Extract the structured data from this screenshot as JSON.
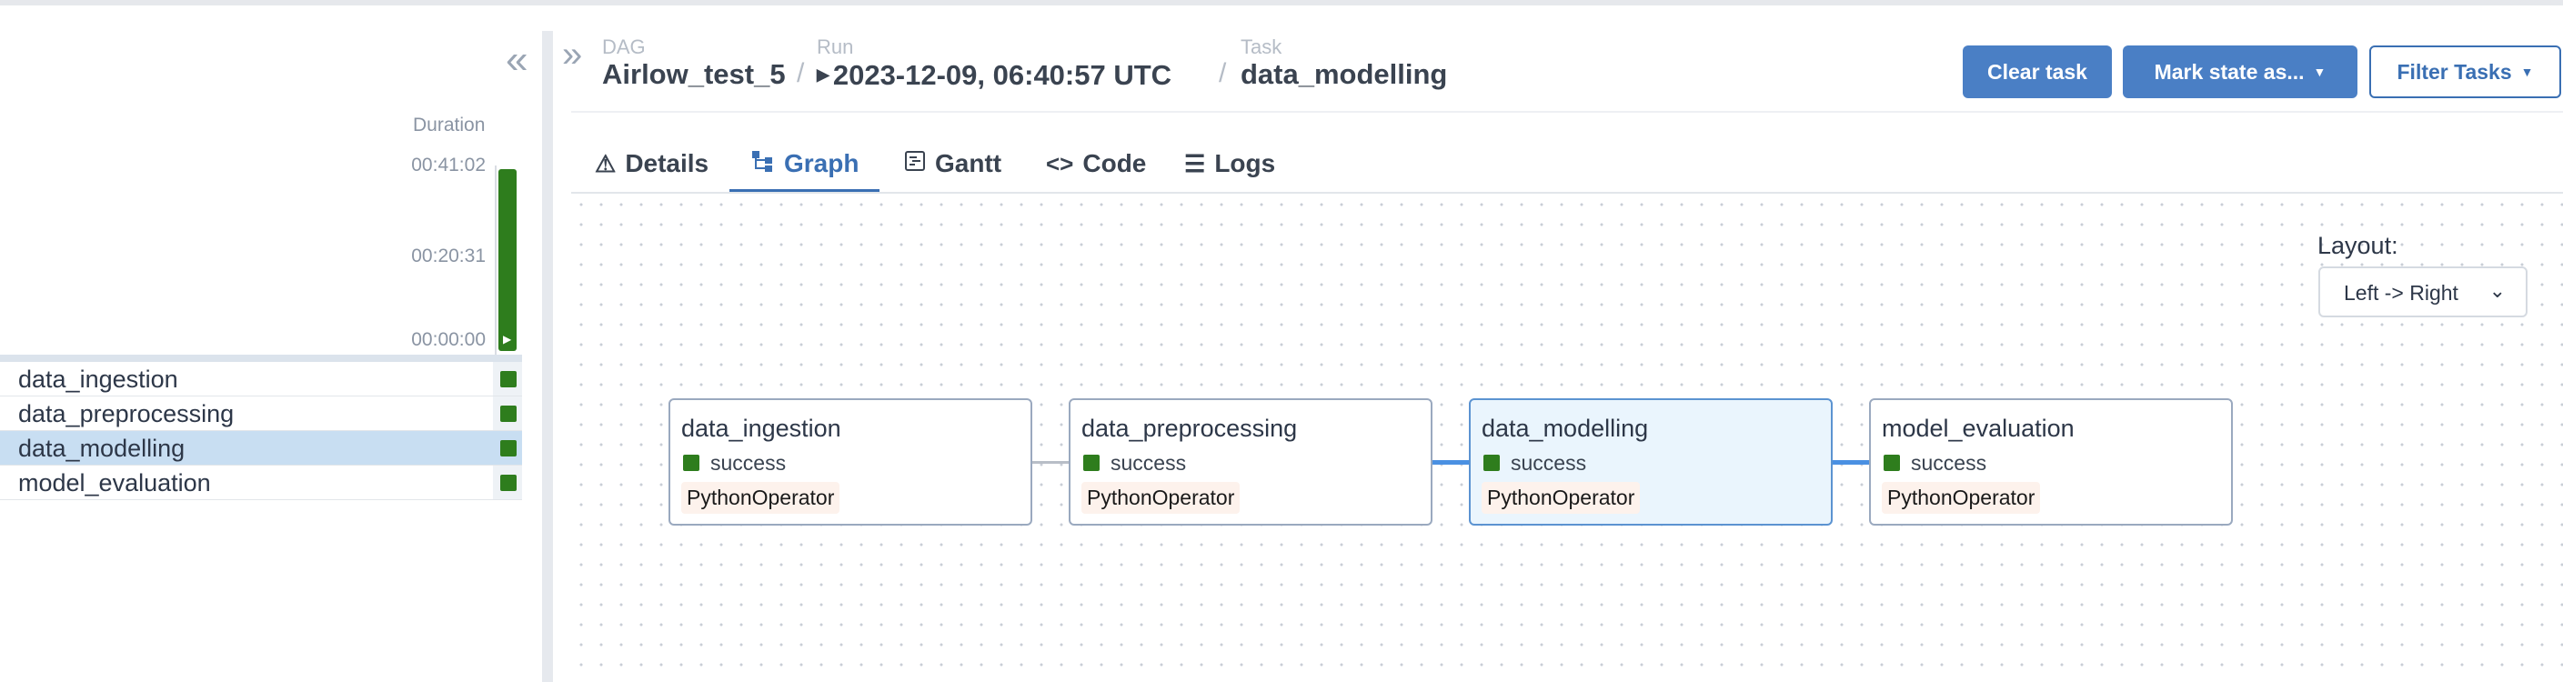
{
  "grid": {
    "duration_label": "Duration",
    "ticks": [
      "00:41:02",
      "00:20:31",
      "00:00:00"
    ],
    "rows": [
      {
        "label": "data_ingestion",
        "status": "success"
      },
      {
        "label": "data_preprocessing",
        "status": "success"
      },
      {
        "label": "data_modelling",
        "status": "success",
        "selected": true
      },
      {
        "label": "model_evaluation",
        "status": "success"
      }
    ]
  },
  "breadcrumb": {
    "dag_key": "DAG",
    "dag_value": "Airlow_test_5",
    "run_key": "Run",
    "run_value": "2023-12-09, 06:40:57 UTC",
    "task_key": "Task",
    "task_value": "data_modelling",
    "separator": "/"
  },
  "actions": {
    "clear_task": "Clear task",
    "mark_state": "Mark state as...",
    "filter_tasks": "Filter Tasks"
  },
  "tabs": [
    {
      "label": "Details",
      "icon": "warning-icon"
    },
    {
      "label": "Graph",
      "icon": "graph-icon",
      "active": true
    },
    {
      "label": "Gantt",
      "icon": "gantt-icon"
    },
    {
      "label": "Code",
      "icon": "code-icon"
    },
    {
      "label": "Logs",
      "icon": "list-icon"
    }
  ],
  "graph": {
    "layout_label": "Layout:",
    "layout_value": "Left -> Right",
    "nodes": [
      {
        "name": "data_ingestion",
        "status": "success",
        "operator": "PythonOperator"
      },
      {
        "name": "data_preprocessing",
        "status": "success",
        "operator": "PythonOperator"
      },
      {
        "name": "data_modelling",
        "status": "success",
        "operator": "PythonOperator",
        "selected": true
      },
      {
        "name": "model_evaluation",
        "status": "success",
        "operator": "PythonOperator"
      }
    ]
  },
  "colors": {
    "success": "#2e7d1d",
    "primary": "#4a7fc5",
    "selected_row": "#c8def2",
    "edge_highlight": "#4a90e2"
  }
}
